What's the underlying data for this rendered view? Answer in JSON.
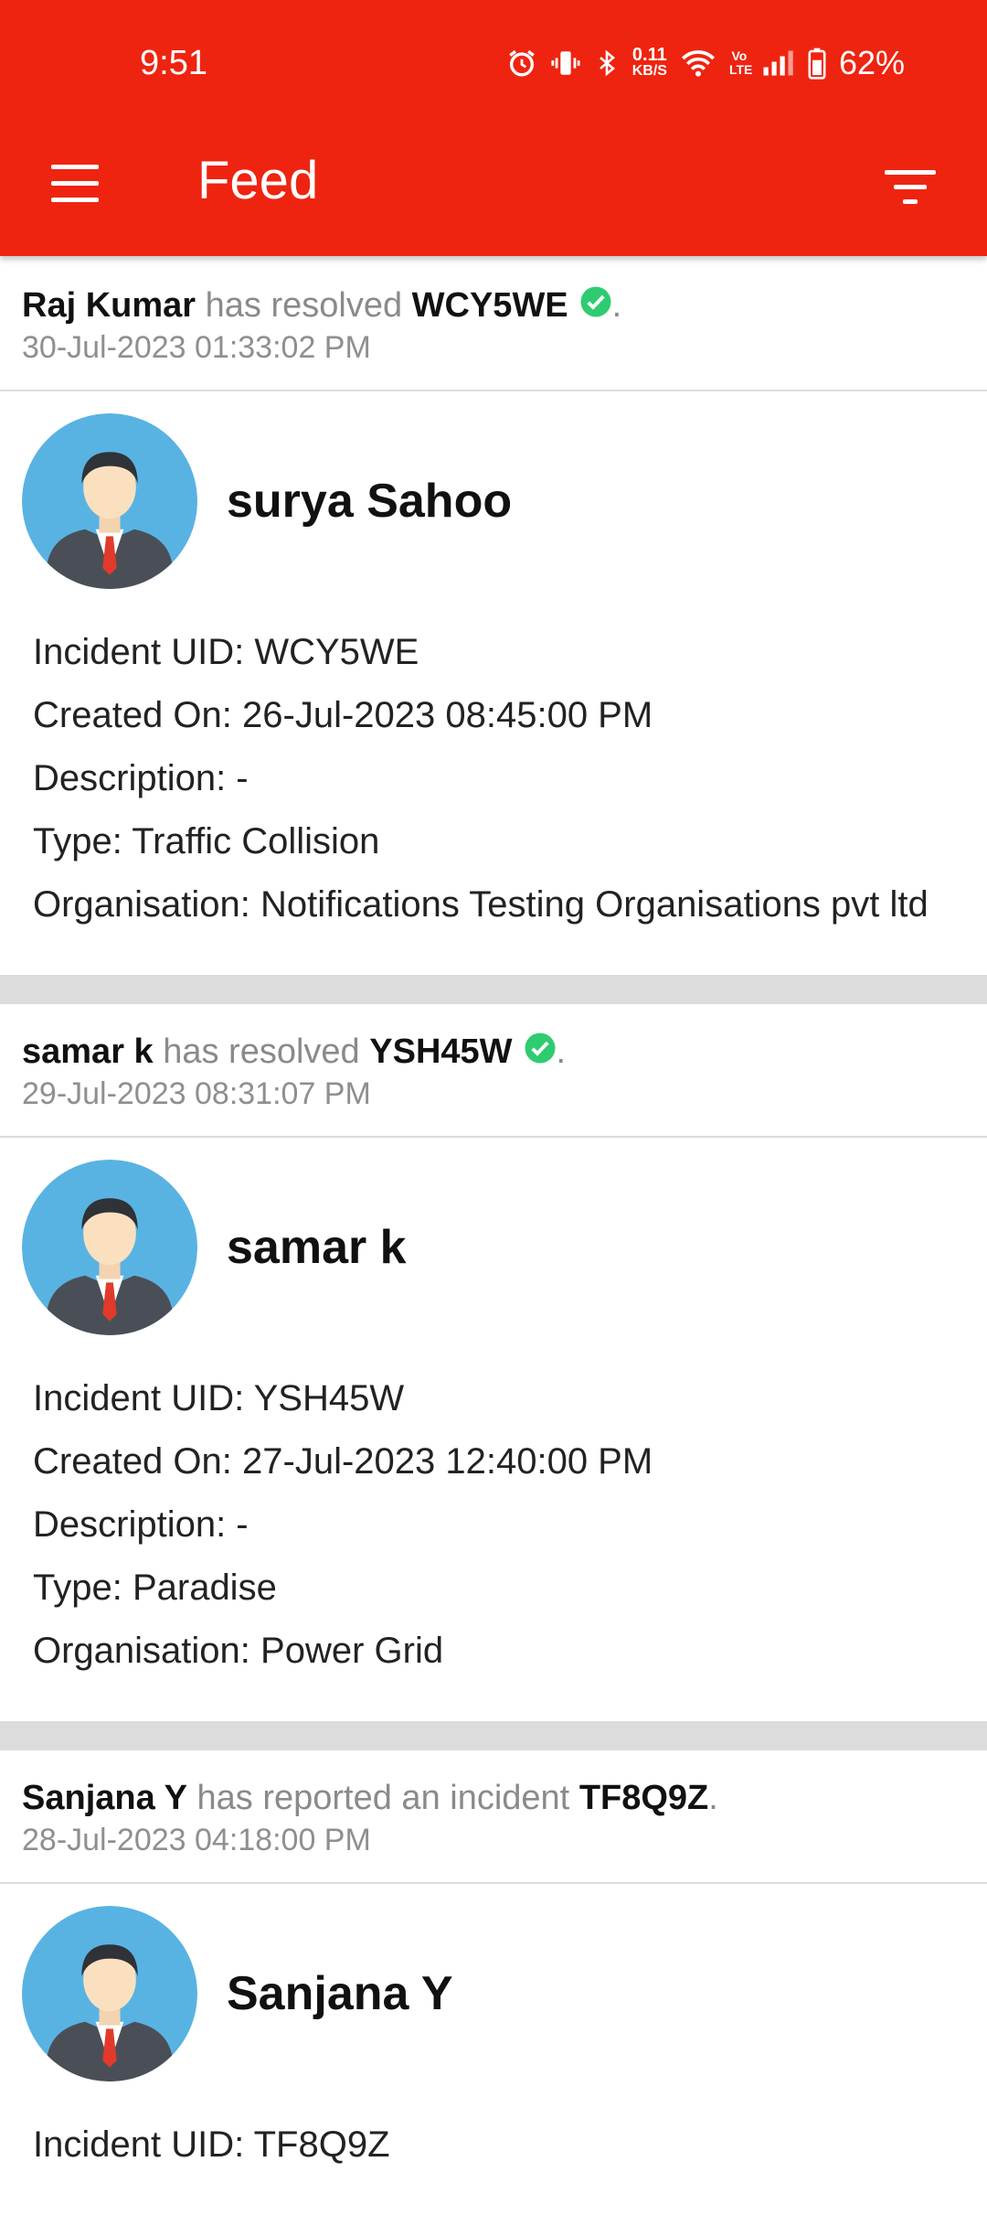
{
  "status_bar": {
    "time": "9:51",
    "net_speed_value": "0.11",
    "net_speed_unit": "KB/S",
    "volte_label": "Vo LTE",
    "battery": "62%",
    "icons": [
      "alarm-icon",
      "vibrate-icon",
      "bluetooth-icon",
      "wifi-icon",
      "signal-icon",
      "battery-icon"
    ]
  },
  "app_bar": {
    "title": "Feed",
    "menu_icon": "hamburger-menu-icon",
    "filter_icon": "filter-icon"
  },
  "feed": [
    {
      "activity": {
        "actor": "Raj Kumar",
        "verb": "has resolved",
        "uid": "WCY5WE",
        "resolved": true,
        "suffix": ".",
        "time": "30-Jul-2023 01:33:02 PM"
      },
      "card": {
        "name": "surya Sahoo",
        "uid_line": "Incident UID: WCY5WE",
        "created_line": "Created On: 26-Jul-2023 08:45:00 PM",
        "description_line": "Description: -",
        "type_line": "Type: Traffic Collision",
        "organisation_line": "Organisation: Notifications Testing Organisations pvt ltd"
      }
    },
    {
      "activity": {
        "actor": "samar k",
        "verb": "has resolved",
        "uid": "YSH45W",
        "resolved": true,
        "suffix": ".",
        "time": "29-Jul-2023 08:31:07 PM"
      },
      "card": {
        "name": "samar k",
        "uid_line": "Incident UID: YSH45W",
        "created_line": "Created On: 27-Jul-2023 12:40:00 PM",
        "description_line": "Description: -",
        "type_line": "Type: Paradise",
        "organisation_line": "Organisation: Power Grid"
      }
    },
    {
      "activity": {
        "actor": "Sanjana Y",
        "verb": "has reported an incident",
        "uid": "TF8Q9Z",
        "resolved": false,
        "suffix": ".",
        "time": "28-Jul-2023 04:18:00 PM"
      },
      "card": {
        "name": "Sanjana Y",
        "uid_line": "Incident UID: TF8Q9Z"
      }
    }
  ],
  "colors": {
    "primary": "#ee2410",
    "check": "#2ecc71",
    "muted": "#8a8a8a",
    "separator": "#dcdcdc"
  }
}
